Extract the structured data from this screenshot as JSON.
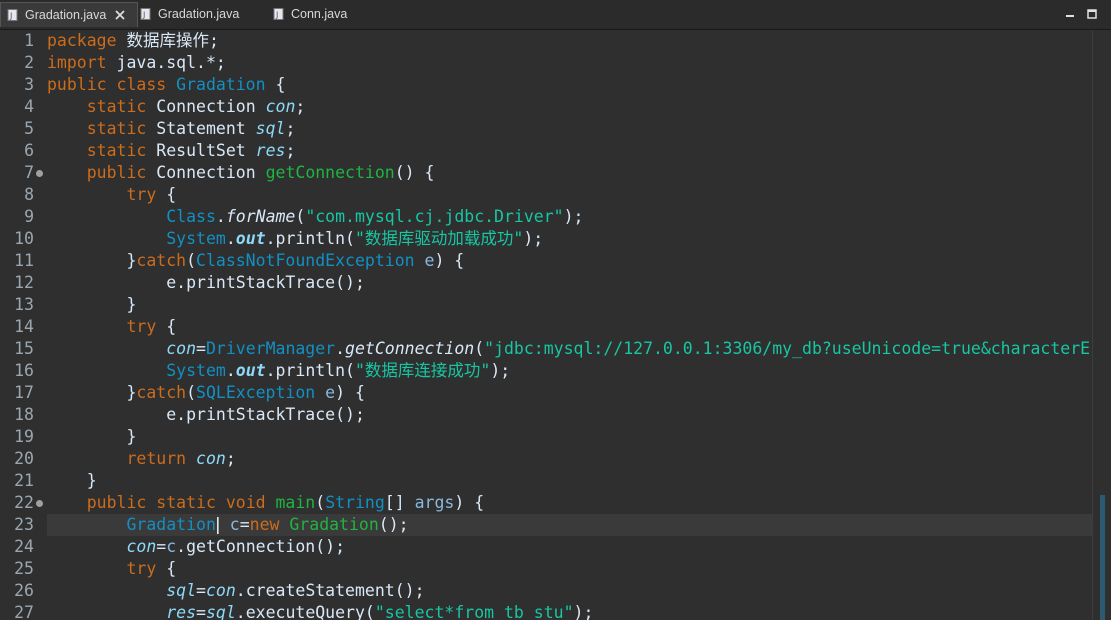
{
  "tabs": [
    {
      "label": "Gradation.java",
      "active": true
    },
    {
      "label": "Gradation.java",
      "active": false
    },
    {
      "label": "Conn.java",
      "active": false
    }
  ],
  "lines": [
    {
      "n": "1",
      "tokens": [
        [
          "k",
          "package"
        ],
        [
          "p",
          " 数据库操作;"
        ]
      ]
    },
    {
      "n": "2",
      "tokens": [
        [
          "k",
          "import"
        ],
        [
          "p",
          " java.sql.*;"
        ]
      ]
    },
    {
      "n": "3",
      "tokens": [
        [
          "k",
          "public class "
        ],
        [
          "t",
          "Gradation"
        ],
        [
          "p",
          " {"
        ]
      ]
    },
    {
      "n": "4",
      "tokens": [
        [
          "p",
          "    "
        ],
        [
          "k",
          "static "
        ],
        [
          "p",
          "Connection "
        ],
        [
          "fi",
          "con"
        ],
        [
          "p",
          ";"
        ]
      ]
    },
    {
      "n": "5",
      "tokens": [
        [
          "p",
          "    "
        ],
        [
          "k",
          "static "
        ],
        [
          "p",
          "Statement "
        ],
        [
          "fi",
          "sql"
        ],
        [
          "p",
          ";"
        ]
      ]
    },
    {
      "n": "6",
      "tokens": [
        [
          "p",
          "    "
        ],
        [
          "k",
          "static "
        ],
        [
          "p",
          "ResultSet "
        ],
        [
          "fi",
          "res"
        ],
        [
          "p",
          ";"
        ]
      ]
    },
    {
      "n": "7",
      "marker": true,
      "tokens": [
        [
          "p",
          "    "
        ],
        [
          "k",
          "public "
        ],
        [
          "p",
          "Connection "
        ],
        [
          "f",
          "getConnection"
        ],
        [
          "p",
          "() {"
        ]
      ]
    },
    {
      "n": "8",
      "tokens": [
        [
          "p",
          "        "
        ],
        [
          "k",
          "try"
        ],
        [
          "p",
          " {"
        ]
      ]
    },
    {
      "n": "9",
      "tokens": [
        [
          "p",
          "            "
        ],
        [
          "t",
          "Class"
        ],
        [
          "p",
          "."
        ],
        [
          "fni",
          "forName"
        ],
        [
          "p",
          "("
        ],
        [
          "s",
          "\"com.mysql.cj.jdbc.Driver\""
        ],
        [
          "p",
          ");"
        ]
      ]
    },
    {
      "n": "10",
      "tokens": [
        [
          "p",
          "            "
        ],
        [
          "t",
          "System"
        ],
        [
          "p",
          "."
        ],
        [
          "fbi",
          "out"
        ],
        [
          "p",
          ".println("
        ],
        [
          "s",
          "\"数据库驱动加载成功\""
        ],
        [
          "p",
          ");"
        ]
      ]
    },
    {
      "n": "11",
      "tokens": [
        [
          "p",
          "        }"
        ],
        [
          "k",
          "catch"
        ],
        [
          "p",
          "("
        ],
        [
          "t",
          "ClassNotFoundException"
        ],
        [
          "p",
          " "
        ],
        [
          "v",
          "e"
        ],
        [
          "p",
          ") {"
        ]
      ]
    },
    {
      "n": "12",
      "tokens": [
        [
          "p",
          "            "
        ],
        [
          "p",
          "e.printStackTrace();"
        ]
      ]
    },
    {
      "n": "13",
      "tokens": [
        [
          "p",
          "        }"
        ]
      ]
    },
    {
      "n": "14",
      "tokens": [
        [
          "p",
          "        "
        ],
        [
          "k",
          "try"
        ],
        [
          "p",
          " {"
        ]
      ]
    },
    {
      "n": "15",
      "tokens": [
        [
          "p",
          "            "
        ],
        [
          "fi",
          "con"
        ],
        [
          "p",
          "="
        ],
        [
          "t",
          "DriverManager"
        ],
        [
          "p",
          "."
        ],
        [
          "fni",
          "getConnection"
        ],
        [
          "p",
          "("
        ],
        [
          "s",
          "\"jdbc:mysql://127.0.0.1:3306/my_db?useUnicode=true&characterE"
        ]
      ]
    },
    {
      "n": "16",
      "tokens": [
        [
          "p",
          "            "
        ],
        [
          "t",
          "System"
        ],
        [
          "p",
          "."
        ],
        [
          "fbi",
          "out"
        ],
        [
          "p",
          ".println("
        ],
        [
          "s",
          "\"数据库连接成功\""
        ],
        [
          "p",
          ");"
        ]
      ]
    },
    {
      "n": "17",
      "tokens": [
        [
          "p",
          "        }"
        ],
        [
          "k",
          "catch"
        ],
        [
          "p",
          "("
        ],
        [
          "t",
          "SQLException"
        ],
        [
          "p",
          " "
        ],
        [
          "v",
          "e"
        ],
        [
          "p",
          ") {"
        ]
      ]
    },
    {
      "n": "18",
      "tokens": [
        [
          "p",
          "            "
        ],
        [
          "p",
          "e.printStackTrace();"
        ]
      ]
    },
    {
      "n": "19",
      "tokens": [
        [
          "p",
          "        }"
        ]
      ]
    },
    {
      "n": "20",
      "tokens": [
        [
          "p",
          "        "
        ],
        [
          "k",
          "return "
        ],
        [
          "fi",
          "con"
        ],
        [
          "p",
          ";"
        ]
      ]
    },
    {
      "n": "21",
      "tokens": [
        [
          "p",
          "    }"
        ]
      ]
    },
    {
      "n": "22",
      "marker": true,
      "tokens": [
        [
          "p",
          "    "
        ],
        [
          "k",
          "public static void "
        ],
        [
          "f",
          "main"
        ],
        [
          "p",
          "("
        ],
        [
          "t",
          "String"
        ],
        [
          "p",
          "[] "
        ],
        [
          "v",
          "args"
        ],
        [
          "p",
          ") {"
        ]
      ]
    },
    {
      "n": "23",
      "current": true,
      "tokens": [
        [
          "p",
          "        "
        ],
        [
          "t",
          "Gradation"
        ],
        [
          "cur",
          "|"
        ],
        [
          "p",
          " "
        ],
        [
          "v",
          "c"
        ],
        [
          "p",
          "="
        ],
        [
          "k",
          "new "
        ],
        [
          "f",
          "Gradation"
        ],
        [
          "p",
          "();"
        ]
      ]
    },
    {
      "n": "24",
      "tokens": [
        [
          "p",
          "        "
        ],
        [
          "fi",
          "con"
        ],
        [
          "p",
          "="
        ],
        [
          "v",
          "c"
        ],
        [
          "p",
          ".getConnection();"
        ]
      ]
    },
    {
      "n": "25",
      "tokens": [
        [
          "p",
          "        "
        ],
        [
          "k",
          "try"
        ],
        [
          "p",
          " {"
        ]
      ]
    },
    {
      "n": "26",
      "tokens": [
        [
          "p",
          "            "
        ],
        [
          "fi",
          "sql"
        ],
        [
          "p",
          "="
        ],
        [
          "fi",
          "con"
        ],
        [
          "p",
          ".createStatement();"
        ]
      ]
    },
    {
      "n": "27",
      "tokens": [
        [
          "p",
          "            "
        ],
        [
          "fi",
          "res"
        ],
        [
          "p",
          "="
        ],
        [
          "fi",
          "sql"
        ],
        [
          "p",
          ".executeQuery("
        ],
        [
          "s",
          "\"select*from tb_stu\""
        ],
        [
          "p",
          ");"
        ]
      ]
    }
  ]
}
